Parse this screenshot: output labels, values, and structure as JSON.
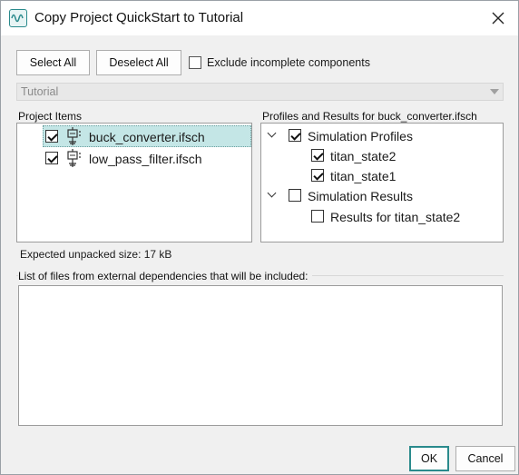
{
  "window": {
    "title": "Copy Project QuickStart to Tutorial",
    "app_icon": "waveform-icon",
    "close_icon": "close-icon"
  },
  "toolbar": {
    "select_all_label": "Select All",
    "deselect_all_label": "Deselect All",
    "exclude_incomplete_label": "Exclude incomplete components",
    "exclude_incomplete_checked": false
  },
  "destination": {
    "selected": "Tutorial"
  },
  "project_items": {
    "label": "Project Items",
    "items": [
      {
        "label": "buck_converter.ifsch",
        "checked": true,
        "selected": true,
        "icon": "schematic-icon"
      },
      {
        "label": "low_pass_filter.ifsch",
        "checked": true,
        "selected": false,
        "icon": "schematic-icon"
      }
    ]
  },
  "profiles": {
    "label": "Profiles and Results for buck_converter.ifsch",
    "groups": [
      {
        "label": "Simulation Profiles",
        "checked": true,
        "expanded": true,
        "children": [
          {
            "label": "titan_state2",
            "checked": true
          },
          {
            "label": "titan_state1",
            "checked": true
          }
        ]
      },
      {
        "label": "Simulation Results",
        "checked": false,
        "expanded": true,
        "children": [
          {
            "label": "Results for titan_state2",
            "checked": false
          }
        ]
      }
    ]
  },
  "unpacked_size": "Expected unpacked size: 17 kB",
  "dependencies": {
    "label": "List of files from external dependencies that will be included:",
    "files": []
  },
  "footer": {
    "ok_label": "OK",
    "cancel_label": "Cancel"
  },
  "colors": {
    "selection": "#c4e6e6",
    "accent": "#2a8a8c"
  }
}
